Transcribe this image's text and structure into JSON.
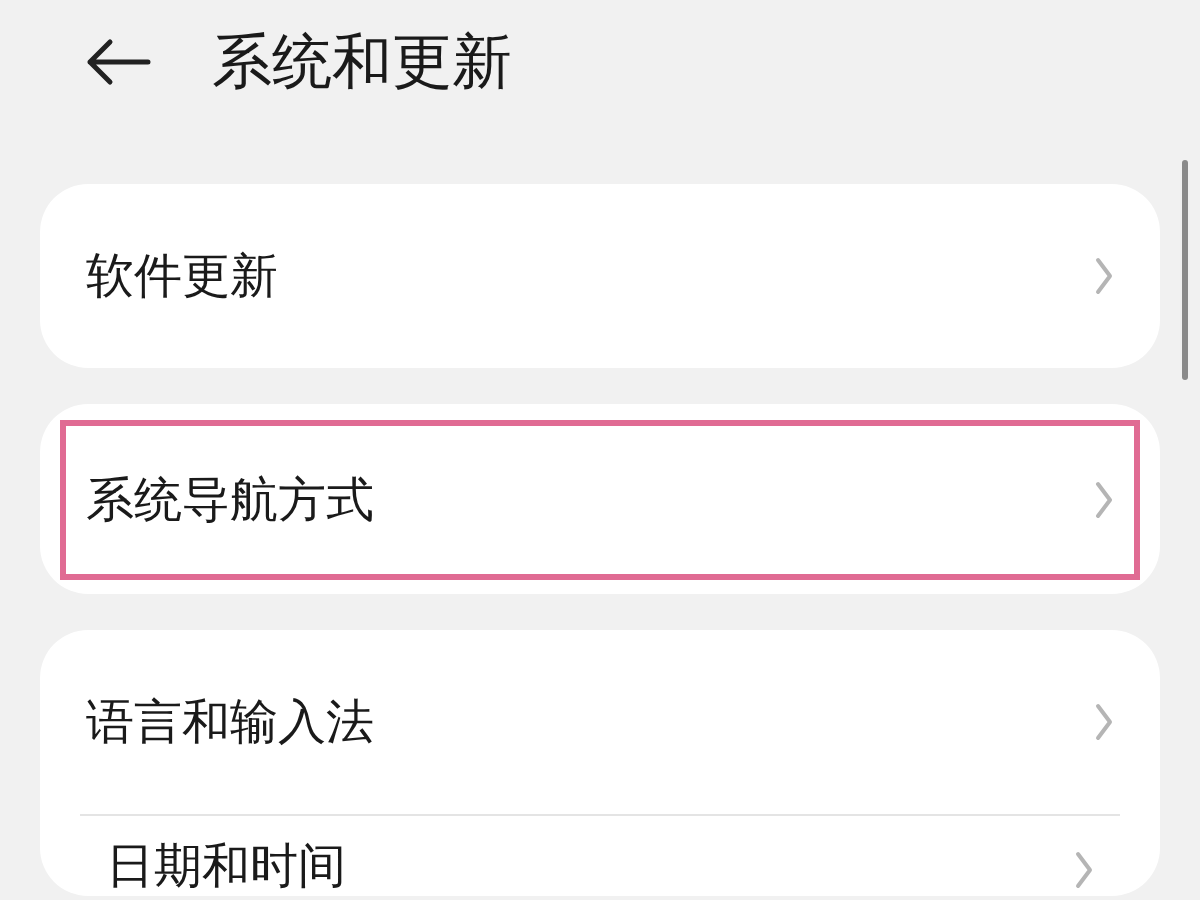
{
  "header": {
    "title": "系统和更新"
  },
  "cards": [
    {
      "items": [
        {
          "label": "软件更新",
          "highlighted": false
        }
      ]
    },
    {
      "items": [
        {
          "label": "系统导航方式",
          "highlighted": true
        }
      ]
    },
    {
      "items": [
        {
          "label": "语言和输入法",
          "highlighted": false
        },
        {
          "label": "日期和时间",
          "highlighted": false
        }
      ]
    }
  ]
}
